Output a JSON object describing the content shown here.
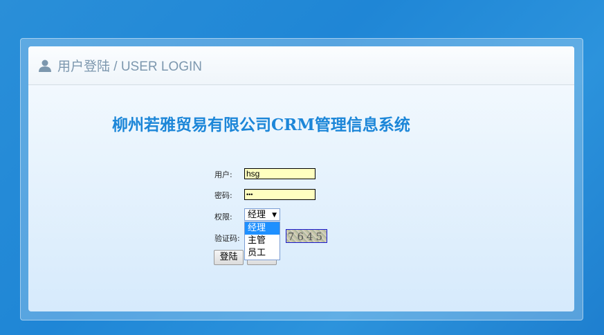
{
  "header": {
    "title": "用户登陆 / USER LOGIN",
    "icon": "user-icon"
  },
  "system_title": "柳州若雅贸易有限公司CRM管理信息系统",
  "form": {
    "username_label": "用户:",
    "username_value": "hsg",
    "password_label": "密码:",
    "password_value": "•••",
    "role_label": "权限:",
    "role_selected": "经理",
    "role_options": [
      "经理",
      "主管",
      "员工"
    ],
    "captcha_label": "验证码:",
    "captcha_text": "7645",
    "login_button": "登陆"
  },
  "colors": {
    "accent": "#1c86d8",
    "background": "#2a8fd8"
  }
}
